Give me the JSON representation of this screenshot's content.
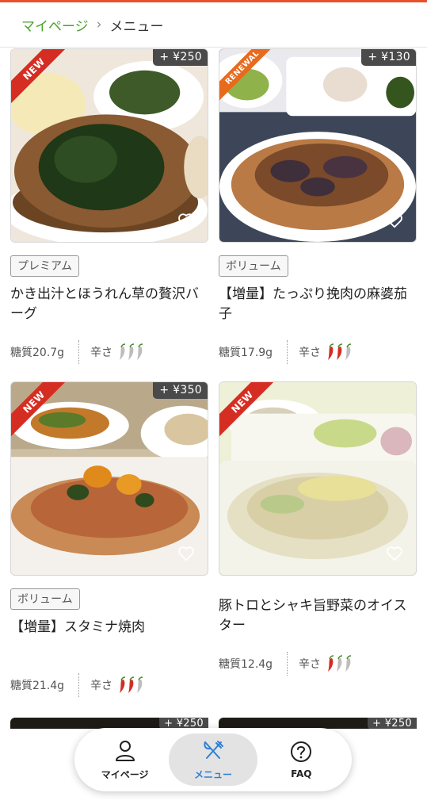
{
  "breadcrumb": {
    "parent": "マイページ",
    "separator": "›",
    "current": "メニュー"
  },
  "menu": [
    {
      "ribbon": "NEW",
      "price": "+ ¥250",
      "badge": "プレミアム",
      "title": "かき出汁とほうれん草の贅沢バーグ",
      "carbs": "糖質20.7g",
      "spice_label": "辛さ",
      "spice_level": 0,
      "favorite": false
    },
    {
      "ribbon": "RENEWAL",
      "price": "+ ¥130",
      "badge": "ボリューム",
      "title": "【増量】たっぷり挽肉の麻婆茄子",
      "carbs": "糖質17.9g",
      "spice_label": "辛さ",
      "spice_level": 2,
      "favorite": false
    },
    {
      "ribbon": "NEW",
      "price": "+ ¥350",
      "badge": "ボリューム",
      "title": "【増量】スタミナ焼肉",
      "carbs": "糖質21.4g",
      "spice_label": "辛さ",
      "spice_level": 2,
      "favorite": false
    },
    {
      "ribbon": "NEW",
      "price": "",
      "badge": "",
      "title": "豚トロとシャキ旨野菜のオイスター",
      "carbs": "糖質12.4g",
      "spice_label": "辛さ",
      "spice_level": 1,
      "favorite": false
    }
  ],
  "peek_prices": [
    "+ ¥250",
    "+ ¥250"
  ],
  "bottom_nav": {
    "items": [
      {
        "label": "マイページ",
        "icon": "person-icon",
        "active": false
      },
      {
        "label": "メニュー",
        "icon": "fork-knife-icon",
        "active": true
      },
      {
        "label": "FAQ",
        "icon": "question-circle-icon",
        "active": false
      }
    ]
  },
  "colors": {
    "accent_green": "#4aa32c",
    "chili_red": "#d62d22",
    "chili_gray": "#bdbdbd",
    "nav_active": "#2f7fd6",
    "top_bar": "#e8502a"
  }
}
